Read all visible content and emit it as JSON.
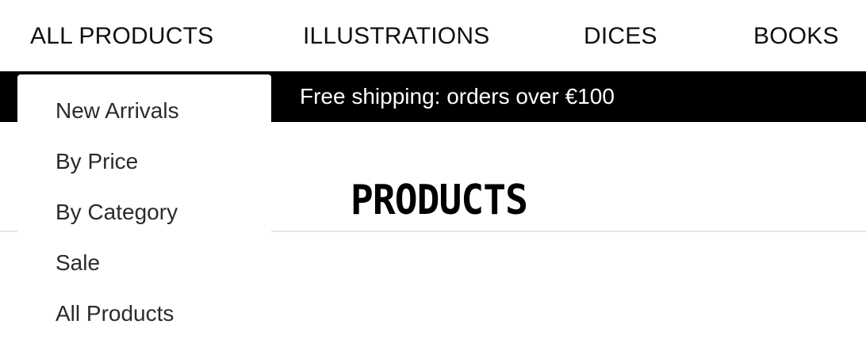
{
  "nav": {
    "items": [
      "ALL PRODUCTS",
      "ILLUSTRATIONS",
      "DICES",
      "BOOKS"
    ]
  },
  "announcement": {
    "text": "Free shipping: orders over €100"
  },
  "page": {
    "title": "PRODUCTS"
  },
  "dropdown": {
    "items": [
      "New Arrivals",
      "By Price",
      "By Category",
      "Sale",
      "All Products"
    ]
  },
  "colors": {
    "announcement_bg": "#000000",
    "announcement_text": "#ffffff",
    "text": "#111111"
  }
}
